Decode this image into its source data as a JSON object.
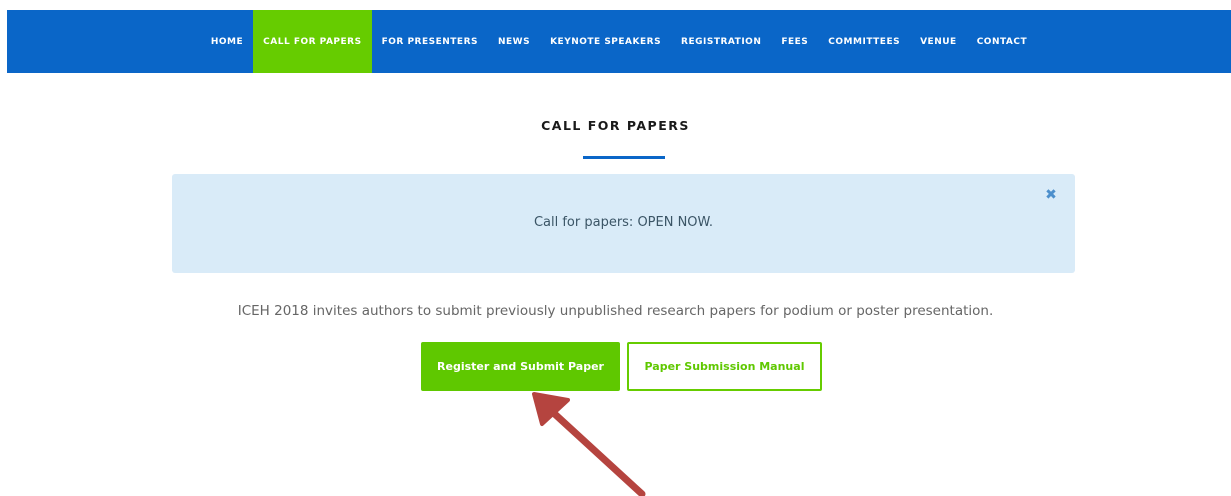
{
  "nav": {
    "items": [
      {
        "label": "HOME",
        "active": false
      },
      {
        "label": "CALL FOR PAPERS",
        "active": true
      },
      {
        "label": "FOR PRESENTERS",
        "active": false
      },
      {
        "label": "NEWS",
        "active": false
      },
      {
        "label": "KEYNOTE SPEAKERS",
        "active": false
      },
      {
        "label": "REGISTRATION",
        "active": false
      },
      {
        "label": "FEES",
        "active": false
      },
      {
        "label": "COMMITTEES",
        "active": false
      },
      {
        "label": "VENUE",
        "active": false
      },
      {
        "label": "CONTACT",
        "active": false
      }
    ]
  },
  "main": {
    "title": "CALL FOR PAPERS",
    "alert": {
      "text": "Call for papers: OPEN NOW.",
      "close_glyph": "✖"
    },
    "intro": "ICEH 2018 invites authors to submit previously unpublished research papers for podium or poster presentation.",
    "buttons": {
      "primary_label": "Register and Submit Paper",
      "secondary_label": "Paper Submission Manual"
    }
  },
  "colors": {
    "nav_bg": "#0a66c8",
    "nav_active": "#66cc00",
    "alert_bg": "#d9ebf8",
    "button_green": "#5fc800",
    "arrow": "#b5443f"
  }
}
